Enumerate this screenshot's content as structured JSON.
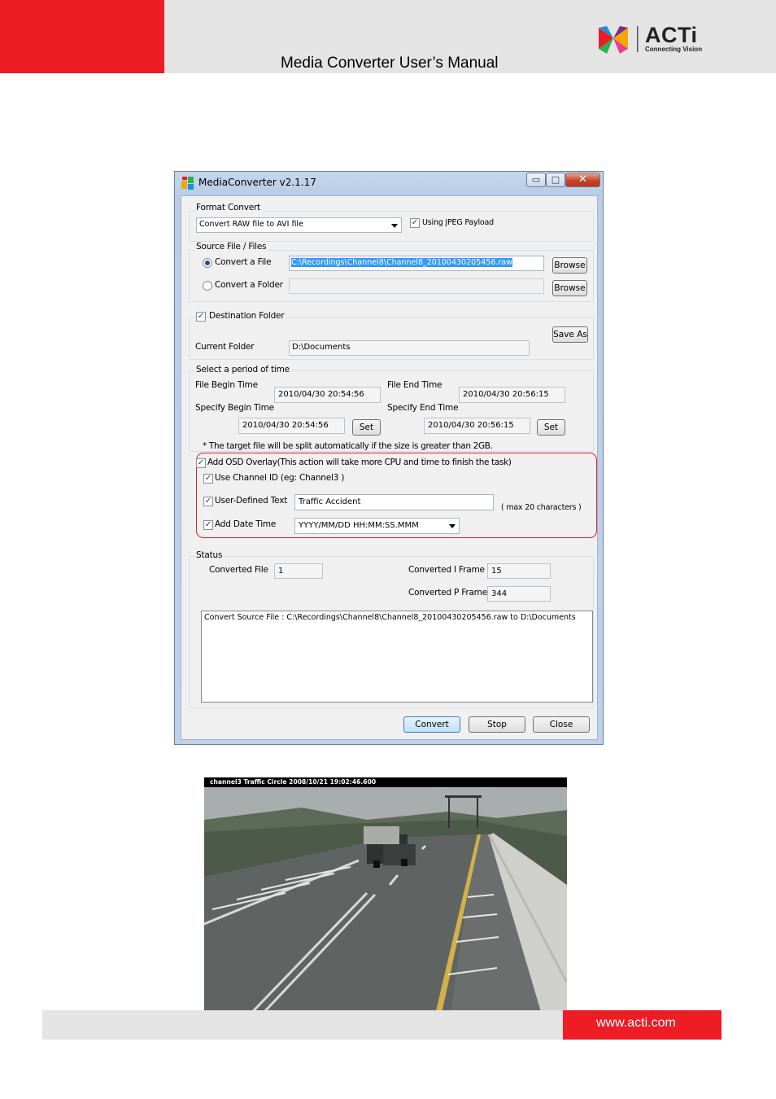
{
  "header": {
    "title": "Media Converter User’s Manual",
    "logo_word": "ACTi",
    "logo_tagline": "Connecting Vision"
  },
  "window": {
    "title": "MediaConverter v2.1.17",
    "controls": {
      "minimize": "▭",
      "maximize": "□",
      "close": "✕"
    },
    "format_convert": {
      "label": "Format Convert",
      "selected": "Convert RAW file to AVI file",
      "jpeg_payload_label": "Using JPEG Payload",
      "jpeg_payload_checked": true
    },
    "source": {
      "label": "Source File / Files",
      "file_option": "Convert a File",
      "folder_option": "Convert a Folder",
      "selected_option": "file",
      "file_path": "C:\\Recordings\\Channel8\\Channel8_20100430205456.raw",
      "folder_path": "",
      "browse_label": "Browse"
    },
    "destination": {
      "label": "Destination Folder",
      "checked": true,
      "current_folder_label": "Current Folder",
      "current_folder": "D:\\Documents",
      "save_as_label": "Save As"
    },
    "period": {
      "label": "Select a period of time",
      "file_begin_label": "File Begin Time",
      "file_begin": "2010/04/30 20:54:56",
      "file_end_label": "File End Time",
      "file_end": "2010/04/30 20:56:15",
      "specify_begin_label": "Specify Begin Time",
      "specify_begin": "2010/04/30 20:54:56",
      "specify_end_label": "Specify End Time",
      "specify_end": "2010/04/30 20:56:15",
      "set_label": "Set",
      "split_note": "* The target file will be split automatically if the size is greater than 2GB."
    },
    "osd": {
      "label": "Add OSD Overlay(This action will take more CPU and time to finish the task)",
      "checked": true,
      "channel_id_label": "Use Channel ID (eg: Channel3 )",
      "channel_id_checked": true,
      "user_text_label": "User-Defined Text",
      "user_text_checked": true,
      "user_text": "Traffic Accident",
      "max_chars_note": "( max 20 characters )",
      "date_time_label": "Add Date Time",
      "date_time_checked": true,
      "date_time_format": "YYYY/MM/DD HH:MM:SS.MMM"
    },
    "status": {
      "label": "Status",
      "converted_file_label": "Converted File",
      "converted_file": "1",
      "i_frame_label": "Converted I Frame",
      "i_frame": "15",
      "p_frame_label": "Converted P Frame",
      "p_frame": "344",
      "log": "Convert Source File : C:\\Recordings\\Channel8\\Channel8_20100430205456.raw to D:\\Documents"
    },
    "buttons": {
      "convert": "Convert",
      "stop": "Stop",
      "close": "Close"
    }
  },
  "camera": {
    "osd_text": "channel3 Traffic Circle 2008/10/21 19:02:46.600"
  },
  "footer": {
    "url": "www.acti.com"
  },
  "colors": {
    "brand_red": "#ee1c25",
    "band_gray": "#e4e4e4",
    "highlight_ring": "#d9232e",
    "selection_blue": "#3399ff"
  }
}
